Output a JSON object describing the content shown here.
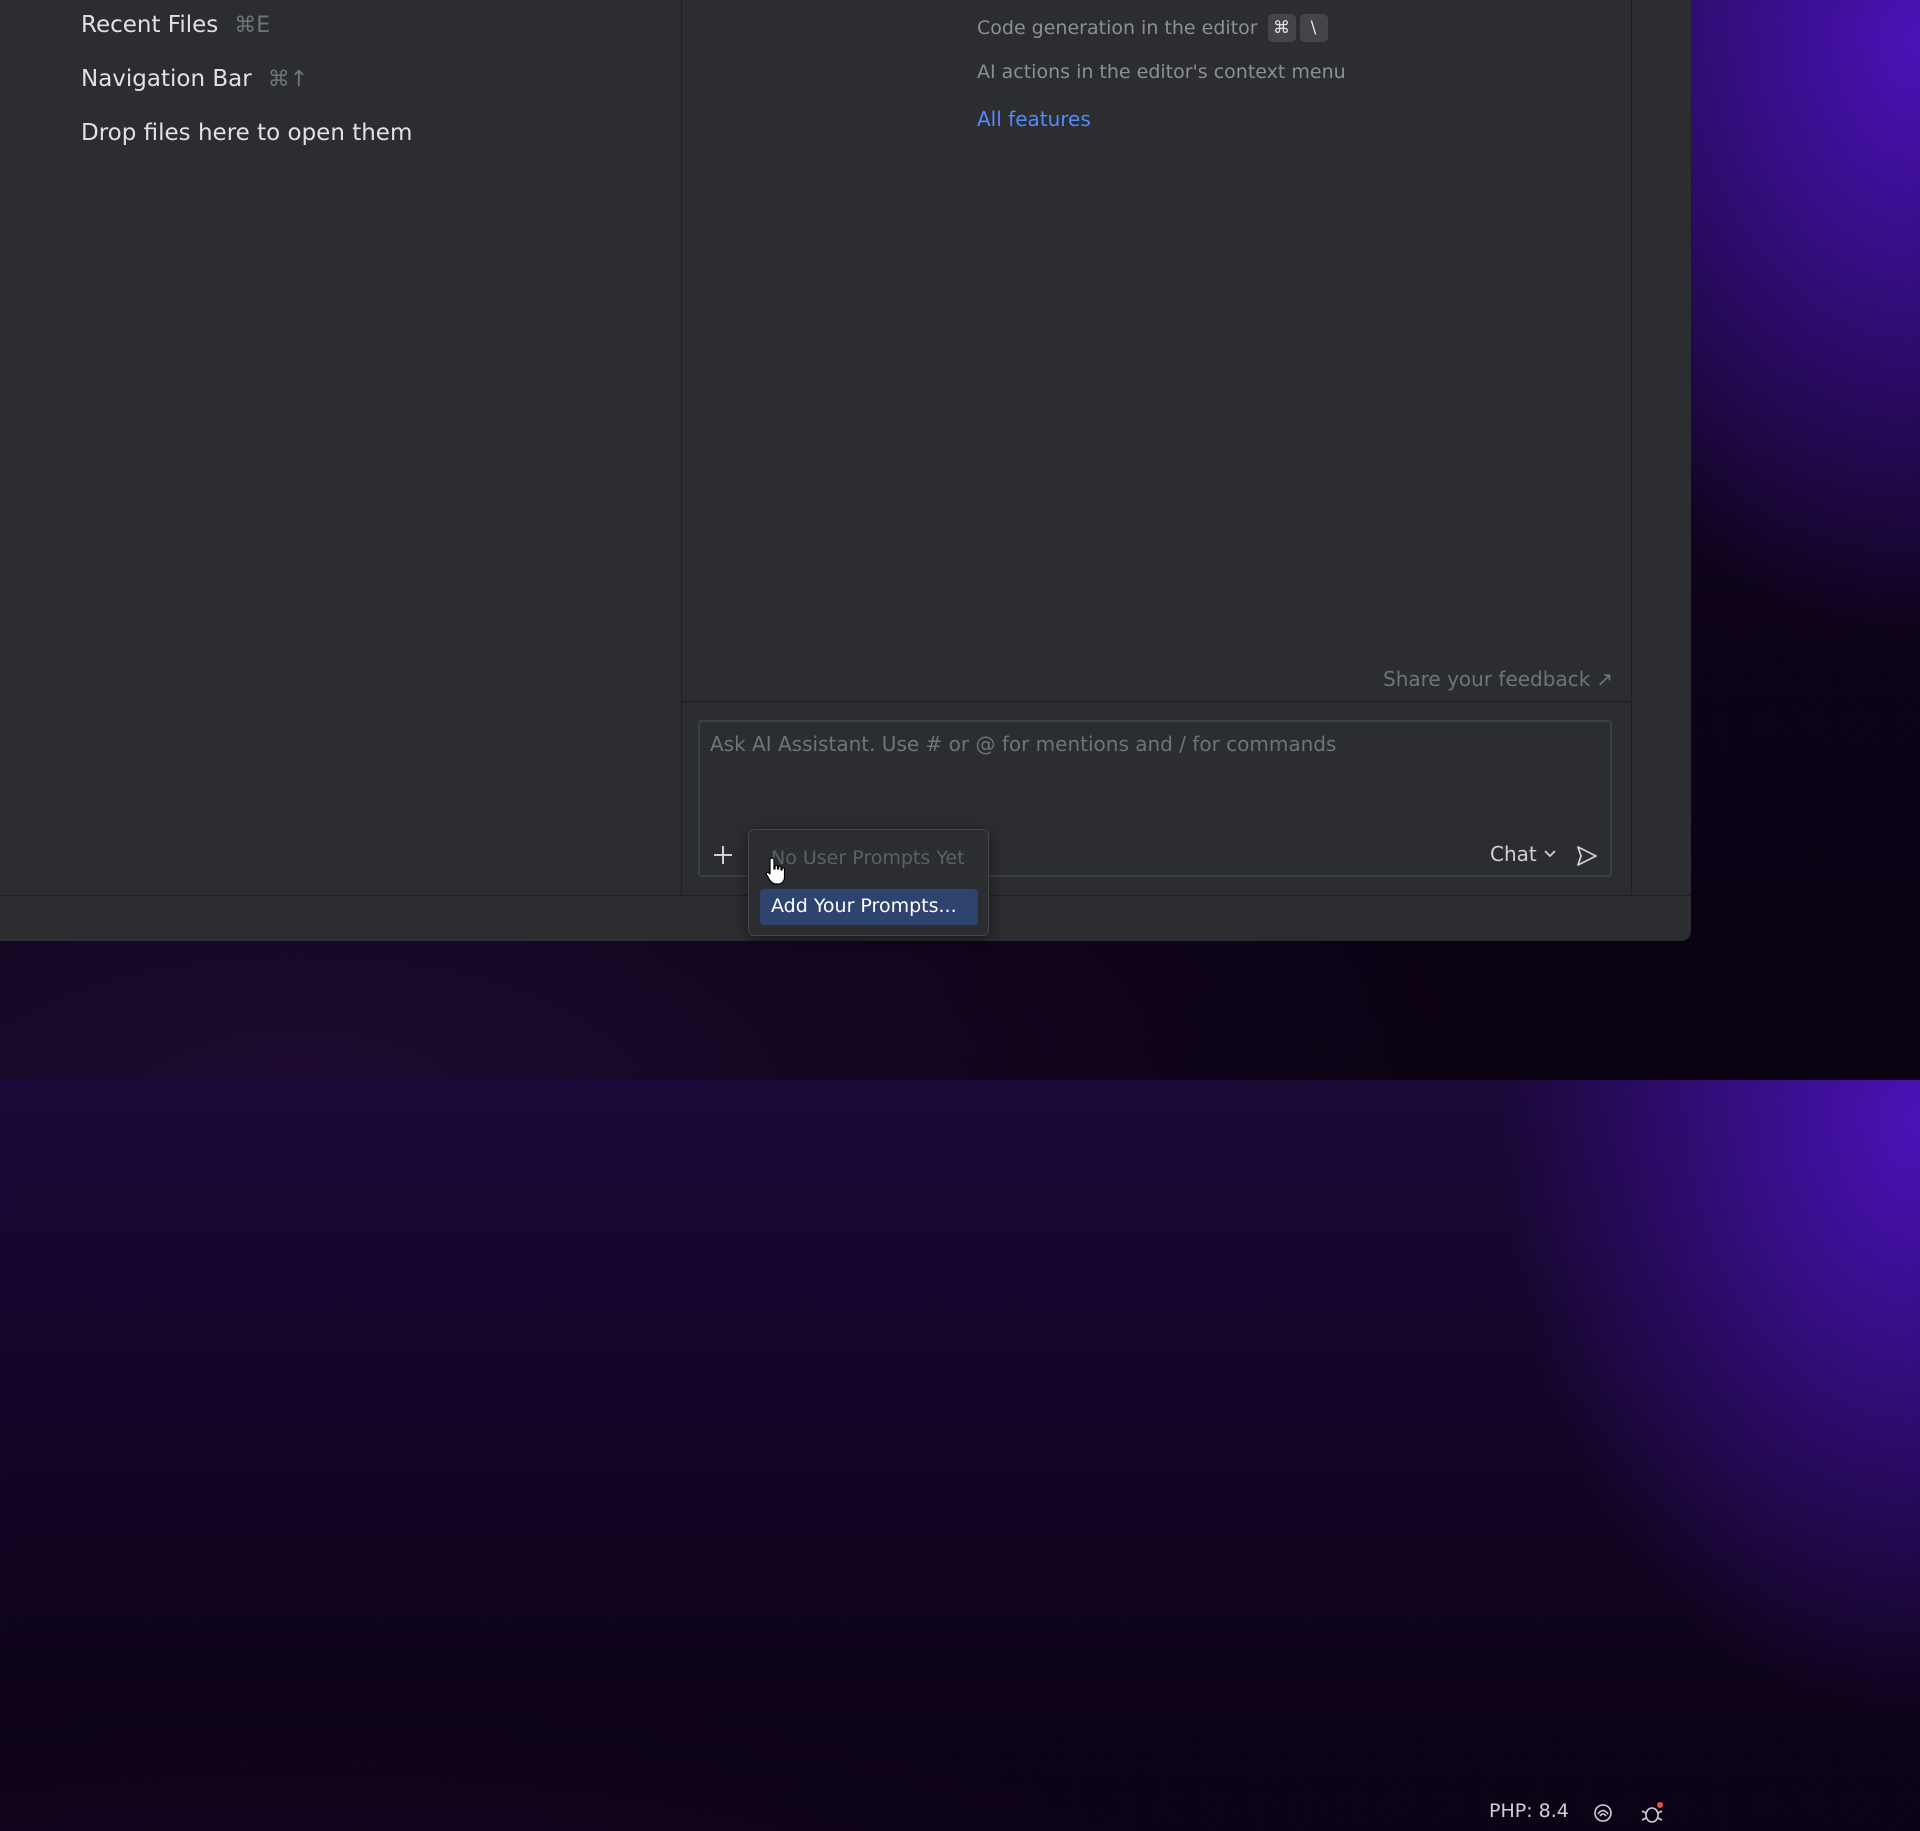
{
  "welcome": {
    "hints": [
      {
        "label": "Recent Files",
        "shortcut": "⌘E"
      },
      {
        "label": "Navigation Bar",
        "shortcut": "⌘↑"
      },
      {
        "label": "Drop files here to open them",
        "shortcut": ""
      }
    ]
  },
  "ai_assistant": {
    "features": [
      {
        "label": "Code generation in the editor",
        "keys": [
          "⌘",
          "\\"
        ]
      },
      {
        "label": "AI actions in the editor's context menu",
        "keys": []
      }
    ],
    "all_features_link": "All features",
    "feedback_link": "Share your feedback",
    "feedback_arrow": "↗",
    "input": {
      "placeholder": "Ask AI Assistant. Use # or @ for mentions and / for commands",
      "value": ""
    },
    "mode": {
      "selected": "Chat"
    },
    "prompts_popup": {
      "empty_text": "No User Prompts Yet",
      "action_label": "Add Your Prompts..."
    }
  },
  "statusbar": {
    "php_version": "PHP: 8.4",
    "icons": [
      "ai-assistant-status-icon",
      "debug-bug-icon"
    ]
  },
  "colors": {
    "accent_link": "#548af7",
    "selection": "#2e436e",
    "panel_bg": "#2b2d30",
    "desktop_purple": "#4a12b8"
  }
}
